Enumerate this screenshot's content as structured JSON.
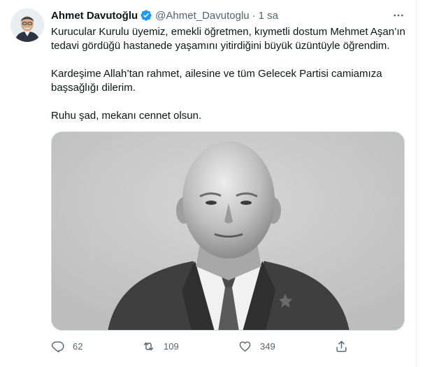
{
  "tweet": {
    "author_name": "Ahmet Davutoğlu",
    "handle": "@Ahmet_Davutoglu",
    "separator": "·",
    "time": "1 sa",
    "paragraphs": [
      "Kurucular Kurulu üyemiz, emekli öğretmen, kıymetli dostum Mehmet Aşan’ın tedavi gördüğü hastanede yaşamını yitirdiğini büyük üzüntüyle öğrendim.",
      "Kardeşime Allah’tan rahmet, ailesine ve tüm Gelecek Partisi camiamıza başsağlığı dilerim.",
      "Ruhu şad, mekanı cennet olsun."
    ]
  },
  "actions": {
    "reply_count": "62",
    "retweet_count": "109",
    "like_count": "349"
  },
  "colors": {
    "verified": "#1d9bf0",
    "muted": "#536471",
    "text": "#0f1419",
    "photo_bg": "#c9c9c9"
  },
  "icons": [
    "verified-badge-icon",
    "more-icon",
    "reply-icon",
    "retweet-icon",
    "like-icon",
    "share-icon"
  ]
}
